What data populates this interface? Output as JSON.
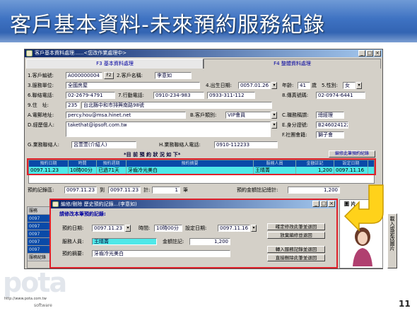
{
  "slide": {
    "title": "客戶基本資料-未來預約服務紀錄",
    "page_number": "11",
    "logo_text": "pota",
    "logo_url": "http://www.pota.com.tw",
    "logo_software": "software"
  },
  "main_window": {
    "caption": "客戶基本資料處理......<您改作業處理中>",
    "btn_min": "_",
    "btn_max": "□",
    "btn_close": "×",
    "tabs": [
      {
        "label": "F3 基本資料處理"
      },
      {
        "label": "F4 整體資料處理"
      }
    ],
    "fields": {
      "cust_id_label": "1.客戶編號:",
      "cust_id_value": "A000000004",
      "f2_button": "F2",
      "cust_name_label": "2.客戶名稱:",
      "cust_name_value": "李意如",
      "service_unit_label": "3.服務單位:",
      "service_unit_value": "全國房屋",
      "birthday_label": "4.出生日期:",
      "birthday_value": "0057.01.26",
      "age_label": "年齡:",
      "age_value": "41",
      "age_unit": "歲",
      "gender_label": "5.性別:",
      "gender_value": "女",
      "contact_phone_label": "6.聯絡電話:",
      "contact_phone_value": "02-2679-4791",
      "mobile_label": "7.行動電話:",
      "mobile_value": "0910-234-983",
      "mobile_value2": "0933-311-112",
      "fax_label": "8.傳真號碼:",
      "fax_value": "02-0974-6441",
      "address_label": "9.住　址:",
      "address_zip": "235",
      "address_value": "台北縣中和市排興南路98號",
      "email_label": "A.電郵地址:",
      "email_value": "percy.hou@msa.hinet.net",
      "category_label": "B.客戶類別:",
      "category_value": "VIP會員",
      "title_label": "C.職務稱謂:",
      "title_value": "總經理",
      "idno_label": "E.身分證號:",
      "idno_value": "B246024122",
      "group_label": "F.社團會籍:",
      "group_value": "獅子會",
      "personal_site_label": "D.經歷個人:",
      "personal_site_value": "takethat@ipsoft.com.tw",
      "liaison_label": "G.業務聯絡人:",
      "liaison_value": "呂萱萱(介紹人)",
      "liaison_phone_label": "H.業務聯絡人電話:",
      "liaison_phone_value": "0910-112233",
      "reservations_header": "*目 前 預 約 狀 況 如 下*",
      "edit_button": "編修此筆預約紀錄",
      "reservation_count_label": "預約記錄區:",
      "reservation_from": "0097.11.23",
      "to_label": "到",
      "reservation_to": "0097.11.23",
      "total_label": "計:",
      "total_value": "1",
      "total_unit": "筆",
      "amount_total_label": "預約金額註記總計:",
      "amount_total_value": "1,200"
    },
    "grid": {
      "columns": [
        "預約日期",
        "時間",
        "預約週期",
        "預約摘要",
        "服務人員",
        "金額註記",
        "設定日期"
      ],
      "rows": [
        [
          "0097.11.23",
          "10時00分",
          "已過71天",
          "牙齒冷光美白",
          "王晴菁",
          "1,200",
          "0097.11.16"
        ]
      ]
    }
  },
  "dialog": {
    "caption": "編修/刪除 歷史預約記錄...(李意如)",
    "heading": "請修改本筆預約記錄:",
    "date_label": "預約日期:",
    "date_value": "0097.11.23",
    "time_label": "時間:",
    "time_value": "10時00分",
    "set_date_label": "設定日期:",
    "set_date_value": "0097.11.16",
    "staff_label": "服務人員:",
    "staff_value": "王晴菁",
    "amount_label": "金額註記:",
    "amount_value": "1,200",
    "summary_label": "預約摘要:",
    "summary_value": "牙齒冷光美白",
    "buttons": [
      "確定修改此筆並退回",
      "放棄編修並退回",
      "轉入服務記錄並退回",
      "直接刪除此筆並退回"
    ]
  },
  "side_panel": {
    "label": "圖 片",
    "vertical_button": "載入或更改圖片"
  },
  "background_list": {
    "header": "服務",
    "footer": "服務紀錄"
  }
}
